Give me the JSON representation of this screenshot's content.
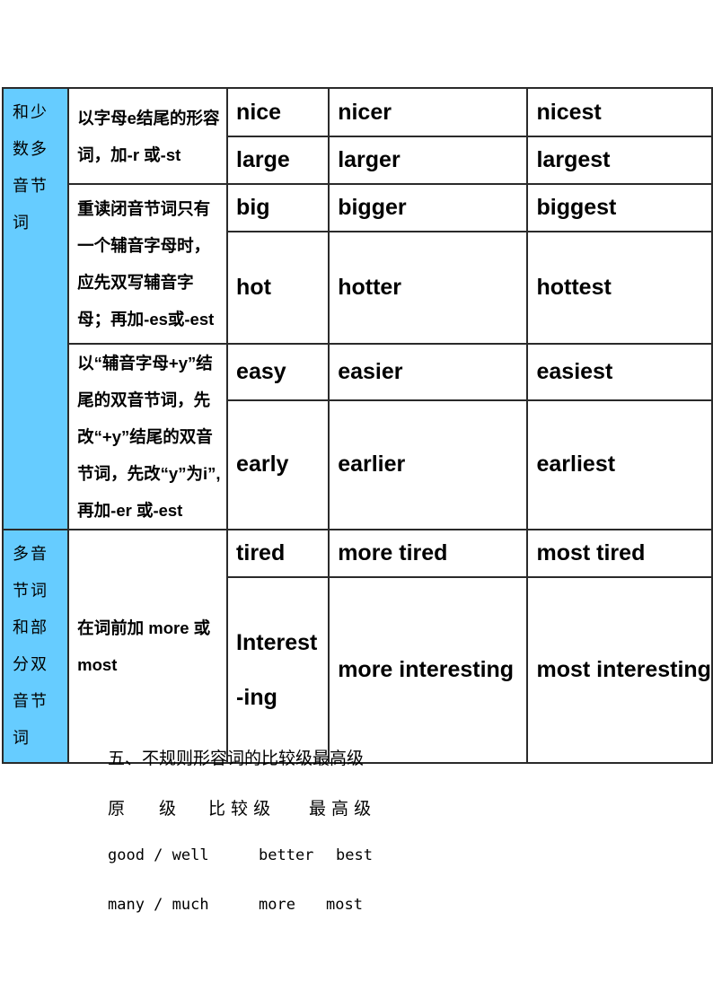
{
  "table": {
    "groups": [
      {
        "category": "和少数多音节词",
        "rules": [
          {
            "rule": "以字母e结尾的形容词，加-r 或-st",
            "rows": [
              [
                "nice",
                "nicer",
                "nicest"
              ],
              [
                "large",
                "larger",
                "largest"
              ]
            ]
          },
          {
            "rule": "重读闭音节词只有一个辅音字母时，应先双写辅音字母；再加-es或-est",
            "rows": [
              [
                "big",
                "bigger",
                "biggest"
              ],
              [
                "hot",
                "hotter",
                "hottest"
              ]
            ]
          },
          {
            "rule": "以“辅音字母+y”结尾的双音节词，先改“+y”结尾的双音节词，先改“y”为i”,再加-er 或-est",
            "rows": [
              [
                "easy",
                "easier",
                "easiest"
              ],
              [
                "early",
                "earlier",
                "earliest"
              ]
            ]
          }
        ]
      },
      {
        "category": "多音节词和部分双音节词",
        "rules": [
          {
            "rule": "在词前加 more 或 most",
            "rows": [
              [
                "tired",
                "more tired",
                "most tired"
              ],
              [
                "Interest-ing",
                "more interesting",
                "most interesting"
              ]
            ]
          }
        ]
      }
    ]
  },
  "section": {
    "heading": "五、不规则形容词的比较级最高级",
    "columns": [
      "原　　级",
      "比 较 级",
      "最 高 级"
    ],
    "rows": [
      [
        "good / well",
        "better",
        "best"
      ],
      [
        "many / much",
        "more",
        "most"
      ]
    ]
  }
}
